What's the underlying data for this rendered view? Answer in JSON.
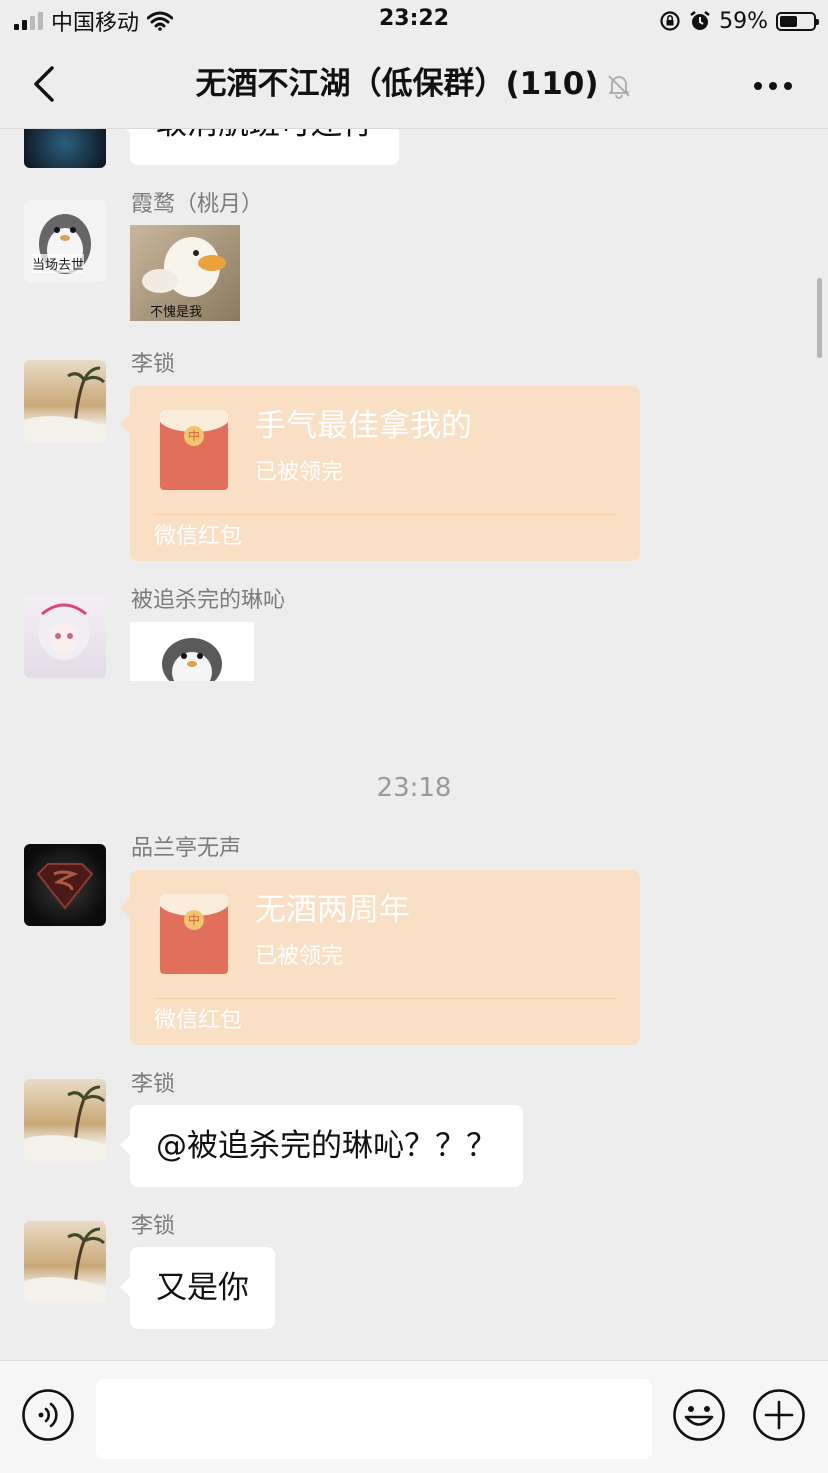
{
  "status_bar": {
    "carrier": "中国移动",
    "time": "23:22",
    "battery_percent": "59%",
    "battery_level": 0.59
  },
  "nav": {
    "title": "无酒不江湖（低保群）(110)",
    "icons": [
      "back-chevron-icon",
      "bell-muted-icon",
      "more-dots-icon"
    ]
  },
  "messages": [
    {
      "type": "text",
      "text": "取消航班可还行"
    },
    {
      "type": "image",
      "sender": "霞鹜（桃月）",
      "avatar_caption": "当场去世",
      "image_caption": "不愧是我"
    },
    {
      "type": "red_packet",
      "sender": "李锁",
      "title": "手气最佳拿我的",
      "status": "已被领完",
      "footer": "微信红包"
    },
    {
      "type": "image",
      "sender": "被追杀完的琳吣"
    },
    {
      "type": "timestamp",
      "text": "23:18"
    },
    {
      "type": "red_packet",
      "sender": "品兰亭无声",
      "title": "无酒两周年",
      "status": "已被领完",
      "footer": "微信红包"
    },
    {
      "type": "text",
      "sender": "李锁",
      "text": "@被追杀完的琳吣？？？"
    },
    {
      "type": "text",
      "sender": "李锁",
      "text": "又是你"
    }
  ],
  "coin_glyph": "中",
  "colors": {
    "background": "#ededed",
    "red_packet_bg": "#f9dfc3",
    "red_packet_icon": "#e0705c",
    "bubble": "#ffffff"
  },
  "input_bar": {
    "icons": [
      "voice-icon",
      "emoji-icon",
      "plus-icon"
    ]
  }
}
